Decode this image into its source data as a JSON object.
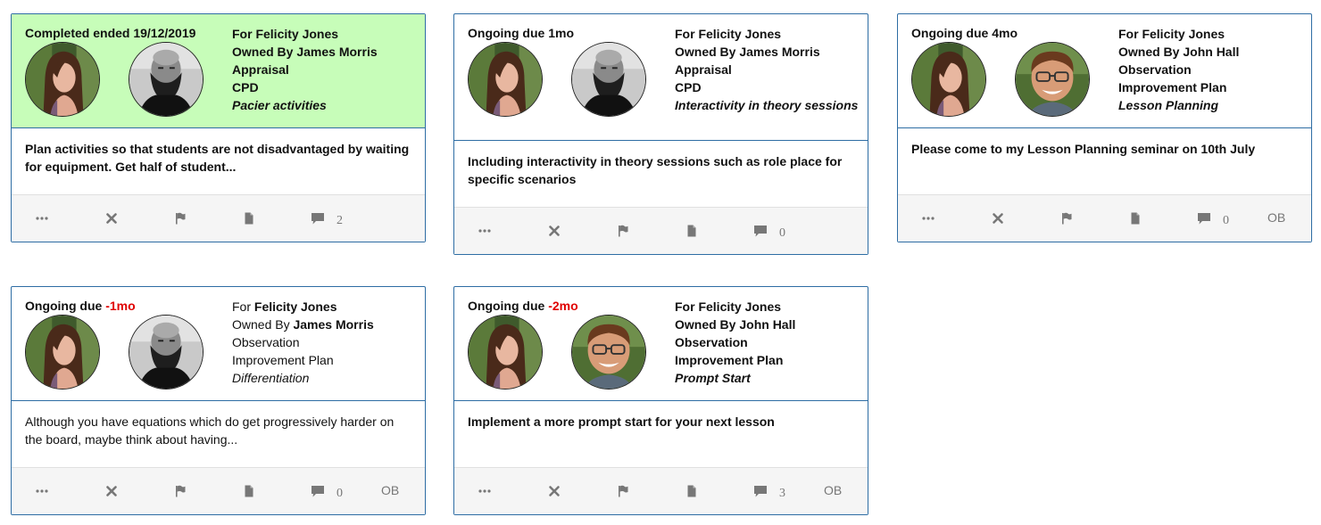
{
  "colors": {
    "border": "#2e6da4",
    "completed_bg": "#c7fdb9",
    "overdue": "#e00000",
    "footer_bg": "#f5f5f5",
    "icon": "#777777"
  },
  "avatar_icons": {
    "felicity": "woman-avatar",
    "james": "bearded-man-avatar",
    "john": "man-glasses-avatar"
  },
  "cards": [
    {
      "status": "Completed ended 19/12/2019",
      "overdue": "",
      "for_prefix": "For ",
      "for_name": "Felicity Jones",
      "owned_prefix": "Owned By ",
      "owned_name": "James Morris",
      "type": "Appraisal",
      "category": "CPD",
      "focus": "Pacier activities",
      "description": "Plan activities so that students are not disadvantaged by waiting for equipment. Get half of student...",
      "comments": "2",
      "tag": ""
    },
    {
      "status": "Ongoing due 1mo",
      "overdue": "",
      "for_prefix": "For ",
      "for_name": "Felicity Jones",
      "owned_prefix": "Owned By ",
      "owned_name": "James Morris",
      "type": "Appraisal",
      "category": "CPD",
      "focus": "Interactivity in theory sessions",
      "description": "Including interactivity in theory sessions such as role place for specific scenarios",
      "comments": "0",
      "tag": ""
    },
    {
      "status": "Ongoing due 4mo",
      "overdue": "",
      "for_prefix": "For ",
      "for_name": "Felicity Jones",
      "owned_prefix": "Owned By ",
      "owned_name": "John Hall",
      "type": "Observation",
      "category": "Improvement Plan",
      "focus": "Lesson Planning",
      "description": "Please come to my Lesson Planning seminar on 10th July",
      "comments": "0",
      "tag": "OB"
    },
    {
      "status": "Ongoing due ",
      "overdue": "-1mo",
      "for_prefix": "For ",
      "for_name": "Felicity Jones",
      "owned_prefix": "Owned By ",
      "owned_name": "James Morris",
      "type": "Observation",
      "category": "Improvement Plan",
      "focus": "Differentiation",
      "description": "Although you have equations which do get progressively harder on the board, maybe think about having...",
      "comments": "0",
      "tag": "OB"
    },
    {
      "status": "Ongoing due ",
      "overdue": "-2mo",
      "for_prefix": "For ",
      "for_name": "Felicity Jones",
      "owned_prefix": "Owned By ",
      "owned_name": "John Hall",
      "type": "Observation",
      "category": "Improvement Plan",
      "focus": "Prompt Start",
      "description": "Implement a more prompt start for your next lesson",
      "comments": "3",
      "tag": "OB"
    }
  ]
}
